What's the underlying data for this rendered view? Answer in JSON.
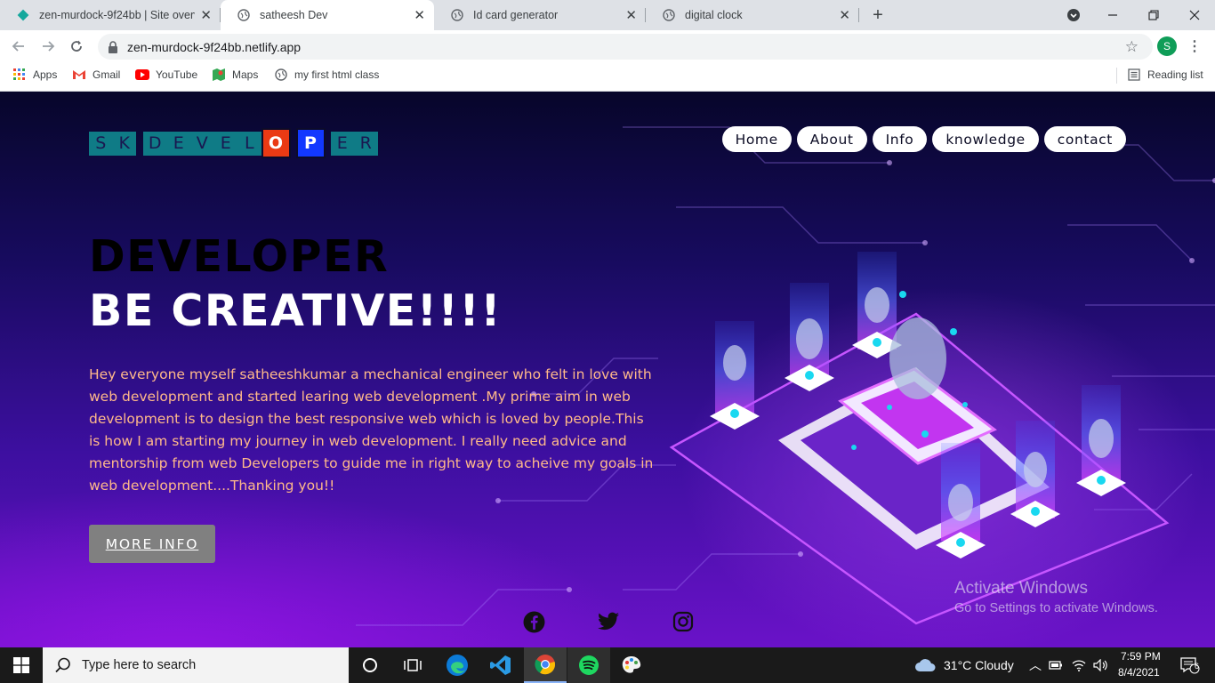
{
  "browser": {
    "tabs": [
      {
        "title": "zen-murdock-9f24bb | Site overv",
        "favicon": "netlify-diamond-icon",
        "active": false
      },
      {
        "title": "satheesh Dev",
        "favicon": "globe-icon",
        "active": true
      },
      {
        "title": "Id card generator",
        "favicon": "globe-icon",
        "active": false
      },
      {
        "title": "digital clock",
        "favicon": "globe-icon",
        "active": false
      }
    ],
    "new_tab": "+",
    "url": "zen-murdock-9f24bb.netlify.app",
    "profile_initial": "S",
    "bookmarks": [
      "Apps",
      "Gmail",
      "YouTube",
      "Maps",
      "my first html class"
    ],
    "reading_list": "Reading list"
  },
  "page": {
    "logo_letters": [
      "S",
      "K",
      "",
      "D",
      "E",
      "V",
      "E",
      "L",
      "O",
      "P",
      "E",
      "R"
    ],
    "nav": [
      "Home",
      "About",
      "Info",
      "knowledge",
      "contact"
    ],
    "heading_line1": "DEVELOPER",
    "heading_line2": "BE CREATIVE!!!!",
    "intro": "Hey everyone myself satheeshkumar a mechanical engineer who felt in love with web development and started learing web development .My prime aim in web development is to design the best responsive web which is loved by people.This is how I am starting my journey in web development. I really need advice and mentorship from web Developers to guide me in right way to acheive my goals in web development....Thanking you!!",
    "more_info_button": "MORE INFO",
    "social": [
      "facebook-icon",
      "twitter-icon",
      "instagram-icon"
    ],
    "colors": {
      "heading_dark": "#000000",
      "heading_light": "#ffffff",
      "intro_text": "#ffb98a",
      "button_bg": "#808080"
    }
  },
  "watermark": {
    "title": "Activate Windows",
    "subtitle": "Go to Settings to activate Windows."
  },
  "taskbar": {
    "search_placeholder": "Type here to search",
    "weather": "31°C  Cloudy",
    "time": "7:59 PM",
    "date": "8/4/2021",
    "notification_count": "6"
  }
}
